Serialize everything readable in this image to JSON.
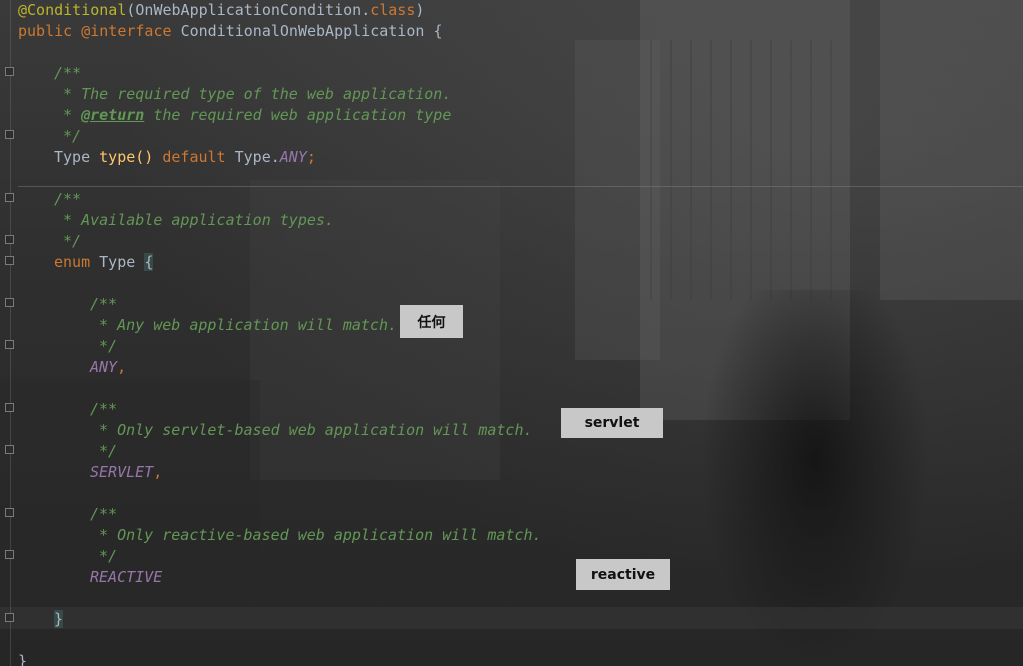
{
  "code": {
    "line1": {
      "annotation": "@Conditional",
      "open": "(",
      "arg": "OnWebApplicationCondition",
      "dot": ".",
      "cls_kw": "class",
      "close": ")"
    },
    "line2": {
      "public": "public",
      "at_interface": "@interface",
      "name": "ConditionalOnWebApplication",
      "brace": "{"
    },
    "line4": "/**",
    "line5": " * The required type of the web application.",
    "line6_star": " * ",
    "line6_tag": "@return",
    "line6_rest": " the required web application type",
    "line7": " */",
    "line8": {
      "type": "Type",
      "method": "type()",
      "default": "default",
      "qualifier": "Type.",
      "any": "ANY",
      "semi": ";"
    },
    "line10": "/**",
    "line11": " * Available application types.",
    "line12": " */",
    "line13": {
      "enum": "enum",
      "name": "Type",
      "brace": "{"
    },
    "line15": "/**",
    "line16": " * Any web application will match.",
    "line17": " */",
    "line18": {
      "const": "ANY",
      "comma": ","
    },
    "line20": "/**",
    "line21": " * Only servlet-based web application will match.",
    "line22": " */",
    "line23": {
      "const": "SERVLET",
      "comma": ","
    },
    "line25": "/**",
    "line26": " * Only reactive-based web application will match.",
    "line27": " */",
    "line28": {
      "const": "REACTIVE"
    },
    "line30": "}",
    "line32": "}"
  },
  "labels": {
    "any": "任何",
    "servlet": "servlet",
    "reactive": "reactive"
  },
  "colors": {
    "background": "#2b2b2b",
    "keyword": "#cc7832",
    "annotation": "#bbb529",
    "doc_comment": "#629755",
    "constant": "#9876aa",
    "identifier": "#a9b7c6",
    "label_box": "#c8c8c8"
  }
}
